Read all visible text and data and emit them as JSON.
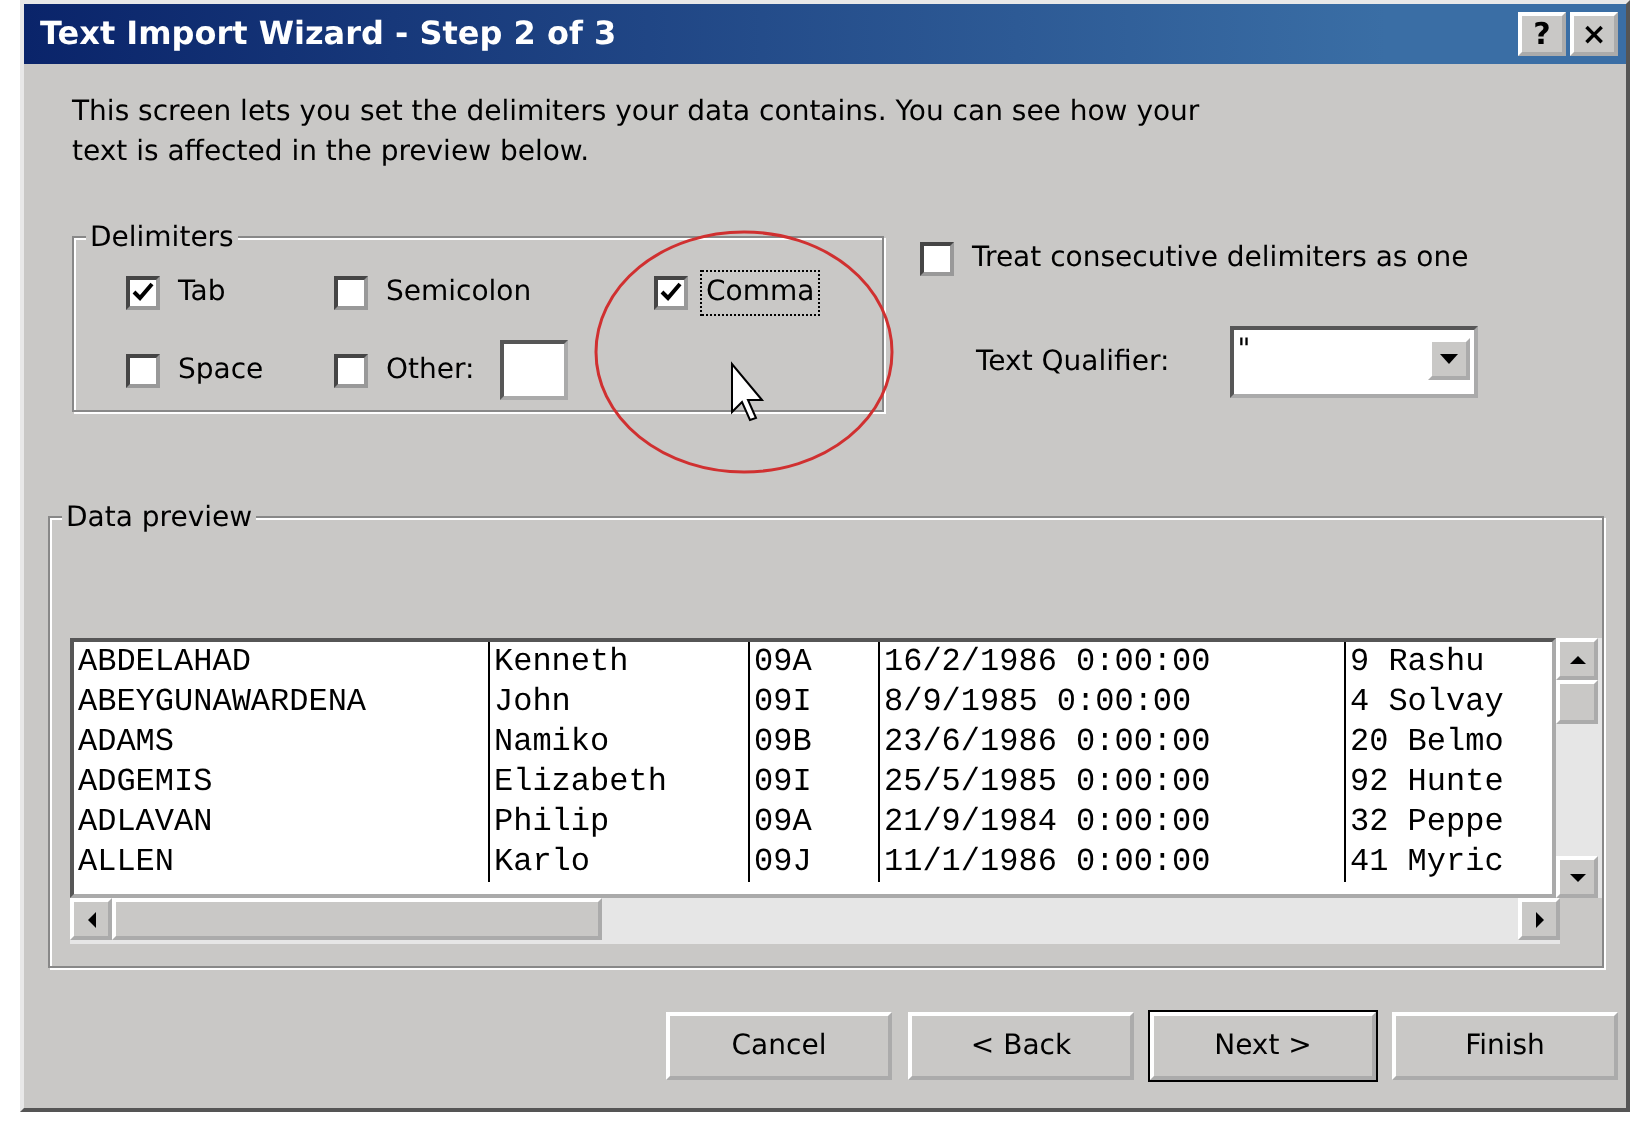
{
  "window": {
    "title": "Text Import Wizard - Step 2 of 3",
    "title_buttons": [
      "?",
      "×"
    ]
  },
  "intro": "This screen lets you set the delimiters your data contains.  You can see how your text is affected in the preview below.",
  "delimiters": {
    "label": "Delimiters",
    "options": [
      {
        "label": "Tab",
        "checked": true,
        "focused": false
      },
      {
        "label": "Semicolon",
        "checked": false,
        "focused": false
      },
      {
        "label": "Comma",
        "checked": true,
        "focused": true
      },
      {
        "label": "Space",
        "checked": false,
        "focused": false
      },
      {
        "label": "Other:",
        "checked": false,
        "focused": false,
        "kind": "field"
      }
    ]
  },
  "consecutive": {
    "label": "Treat consecutive delimiters as one",
    "checked": false
  },
  "text_qualifier": {
    "label": "Text Qualifier:",
    "value": "\""
  },
  "preview": {
    "label": "Data preview",
    "rows": [
      [
        "ABDELAHAD",
        "Kenneth",
        "09A",
        "16/2/1986 0:00:00",
        "9 Rashu"
      ],
      [
        "ABEYGUNAWARDENA",
        "John",
        "09I",
        "8/9/1985 0:00:00",
        "4 Solvay"
      ],
      [
        "ADAMS",
        "Namiko",
        "09B",
        "23/6/1986 0:00:00",
        "20 Belmo"
      ],
      [
        "ADGEMIS",
        "Elizabeth",
        "09I",
        "25/5/1985 0:00:00",
        "92 Hunte"
      ],
      [
        "ADLAVAN",
        "Philip",
        "09A",
        "21/9/1984 0:00:00",
        "32 Peppe"
      ],
      [
        "ALLEN",
        "Karlo",
        "09J",
        "11/1/1986 0:00:00",
        "41 Myric"
      ]
    ]
  },
  "buttons": [
    {
      "label": "Cancel",
      "default": false
    },
    {
      "label": "< Back",
      "default": false
    },
    {
      "label": "Next >",
      "default": true
    },
    {
      "label": "Finish",
      "default": false
    }
  ]
}
